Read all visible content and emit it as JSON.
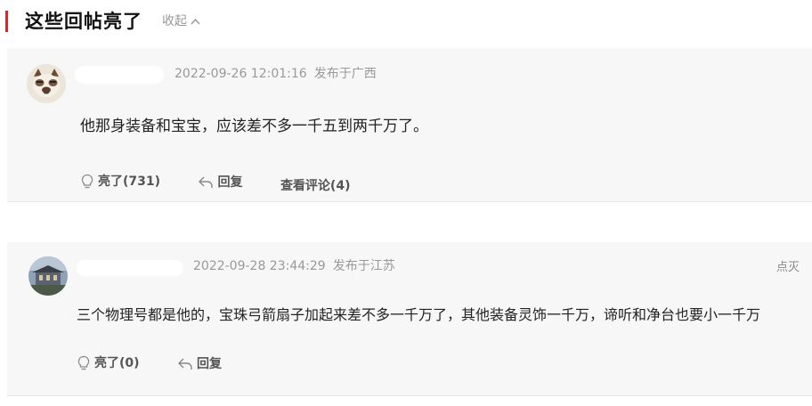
{
  "section": {
    "title": "这些回帖亮了",
    "collapse_label": "收起",
    "chevron": "chevron-up-icon"
  },
  "comments": [
    {
      "avatar": "cat-avatar",
      "timestamp": "2022-09-26 12:01:16",
      "location": "发布于广西",
      "content": "他那身装备和宝宝，应该差不多一千五到两千万了。",
      "like_label": "亮了(731)",
      "reply_label": "回复",
      "view_comments_label": "查看评论(4)"
    },
    {
      "avatar": "photo-avatar",
      "timestamp": "2022-09-28 23:44:29",
      "location": "发布于江苏",
      "content": "三个物理号都是他的，宝珠弓箭扇子加起来差不多一千万了，其他装备灵饰一千万，谛听和净台也要小一千万",
      "like_label": "亮了(0)",
      "reply_label": "回复",
      "report_label": "点灭"
    }
  ],
  "colors": {
    "accent": "#d9262c",
    "card_bg": "#f7f7f7",
    "meta": "#999999"
  }
}
